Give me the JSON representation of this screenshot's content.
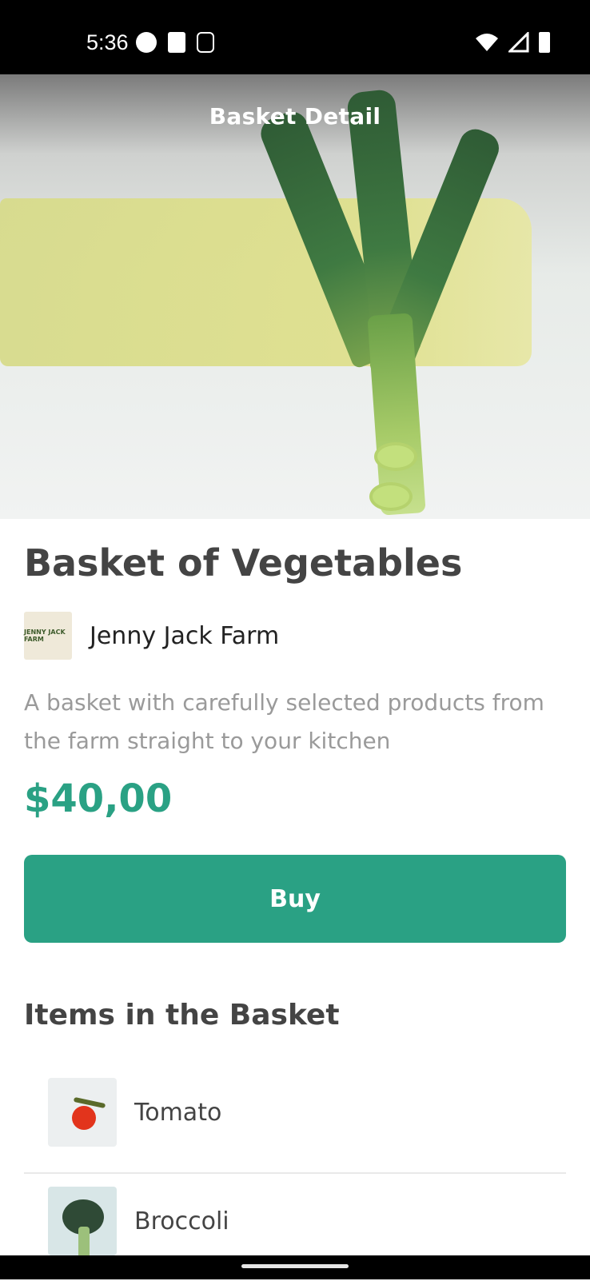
{
  "status_bar": {
    "time": "5:36",
    "left_icons": [
      "a-circle-icon",
      "sd-card-icon",
      "screenshot-icon"
    ],
    "right_icons": [
      "wifi-icon",
      "signal-icon",
      "battery-icon"
    ]
  },
  "header": {
    "title": "Basket Detail"
  },
  "product": {
    "title": "Basket of Vegetables",
    "farm_name": "Jenny Jack Farm",
    "farm_logo_text": "JENNY JACK FARM",
    "description": "A basket with carefully selected products from the farm straight to your kitchen",
    "price": "$40,00",
    "buy_label": "Buy"
  },
  "items_section": {
    "title": "Items in the Basket",
    "items": [
      {
        "label": "Tomato",
        "thumb": "tomato-image"
      },
      {
        "label": "Broccoli",
        "thumb": "broccoli-image"
      }
    ]
  },
  "colors": {
    "accent": "#2aa184",
    "title": "#444444",
    "description": "#9a9a9a",
    "status_bar": "#000000"
  }
}
